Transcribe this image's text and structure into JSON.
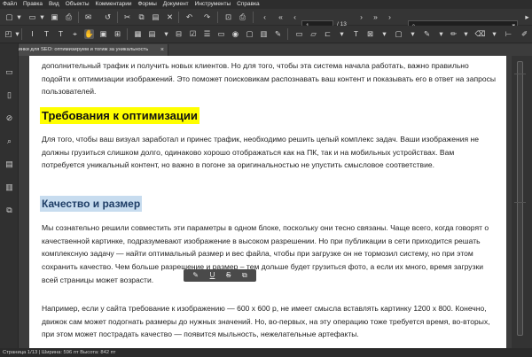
{
  "menu": [
    "Файл",
    "Правка",
    "Вид",
    "Объекты",
    "Комментарии",
    "Формы",
    "Документ",
    "Инструменты",
    "Справка"
  ],
  "toolbar": {
    "page_value": "1",
    "page_total": "/ 13",
    "search_placeholder": ""
  },
  "tab": {
    "title": "*Картинки для SEO: оптимизируем и тогиж за уникальность",
    "close": "×"
  },
  "document": {
    "para1": "дополнительный трафик и получить новых клиентов. Но для того, чтобы эта система начала работать, важно правильно подойти к оптимизации изображений. Это поможет поисковикам распознавать ваш контент и показывать его в ответ на запросы пользователей.",
    "heading1": "Требования к оптимизации",
    "para2": "Для того, чтобы ваш визуал заработал и принес трафик, необходимо решить целый комплекс задач. Ваши изображения не должны грузиться слишком долго, одинаково хорошо отображаться как на ПК, так и на мобильных устройствах. Вам потребуется уникальный контент, но важно в погоне за оригинальностью не упустить смысловое соответствие.",
    "heading2": "Качество и размер",
    "para3": "Мы сознательно решили совместить эти параметры в одном блоке, поскольку они тесно связаны. Чаще всего, когда говорят о качественной картинке, подразумевают изображение в высоком разрешении. Но при публикации в сети приходится решать комплексную задачу — найти оптимальный размер и вес файла, чтобы при загрузке он не тормозил систему, но при этом сохранить качество. Чем больше разрешение и размер – тем дольше будет грузиться фото, а если их много, время загрузки всей страницы может возрасти.",
    "para4": "Например, если у сайта требование к изображению — 600 х 600 р, не имеет смысла вставлять картинку 1200 х 800. Конечно, движок сам может подогнать размеры до нужных значений. Но, во-первых, на эту операцию тоже требуется время, во-вторых, при этом может пострадать качество — появится мыльность, нежелательные артефакты."
  },
  "status": {
    "text": "Страница 1/13 | Ширина: 596 пт Высота: 842 пт"
  }
}
